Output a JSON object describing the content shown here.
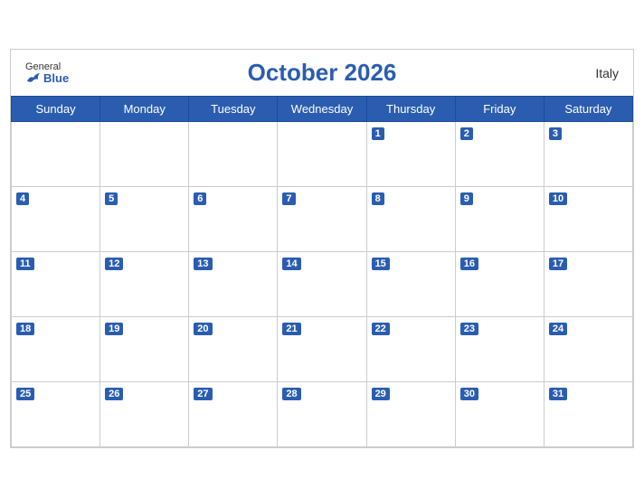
{
  "header": {
    "title": "October 2026",
    "country": "Italy",
    "logo_general": "General",
    "logo_blue": "Blue"
  },
  "days_of_week": [
    "Sunday",
    "Monday",
    "Tuesday",
    "Wednesday",
    "Thursday",
    "Friday",
    "Saturday"
  ],
  "weeks": [
    [
      null,
      null,
      null,
      null,
      1,
      2,
      3
    ],
    [
      4,
      5,
      6,
      7,
      8,
      9,
      10
    ],
    [
      11,
      12,
      13,
      14,
      15,
      16,
      17
    ],
    [
      18,
      19,
      20,
      21,
      22,
      23,
      24
    ],
    [
      25,
      26,
      27,
      28,
      29,
      30,
      31
    ]
  ]
}
